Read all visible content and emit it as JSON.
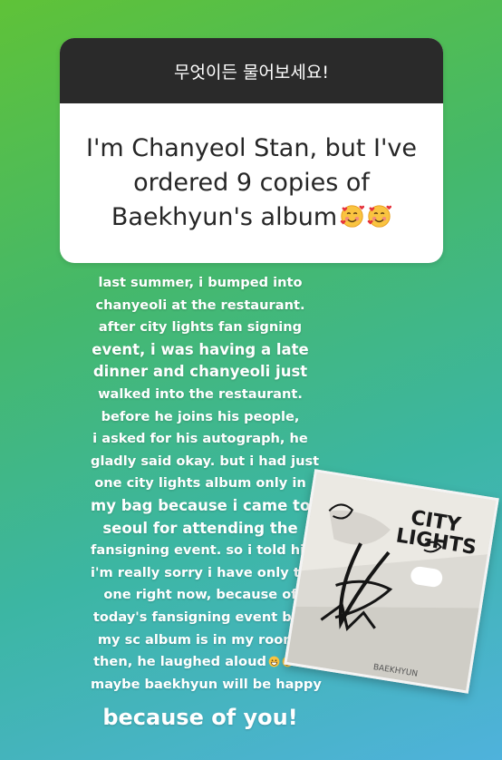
{
  "question_box": {
    "header": "무엇이든 물어보세요!",
    "answer": "I'm Chanyeol Stan, but I've ordered 9 copies of Baekhyun's album"
  },
  "story_text": {
    "lines": [
      "last summer, i bumped into",
      "chanyeoli at the restaurant.",
      "after city lights fan signing",
      "event, i was having a late",
      "dinner and chanyeoli just",
      "walked into the restaurant.",
      "before he joins his people,",
      "i asked for his autograph, he",
      "gladly said okay. but i had just",
      "one city lights album only in",
      "my bag because i came to",
      "seoul for attending the",
      "fansigning event. so i told him",
      "i'm really sorry i have only this",
      "one right now, because of",
      "today's fansigning event but",
      "my sc album is in my room!",
      "then, he laughed aloud",
      "maybe baekhyun will be happy",
      "because of you!"
    ]
  },
  "photo": {
    "album_title_1": "CITY",
    "album_title_2": "LIGHTS",
    "caption": "BAEKHYUN"
  },
  "icons": {
    "heart_face_emoji": "smiling-face-with-hearts",
    "grin_emoji": "grinning-face"
  },
  "colors": {
    "bg_top": "#5fc238",
    "bg_bottom": "#4fb2dc",
    "box_header": "#2a2a2a"
  }
}
